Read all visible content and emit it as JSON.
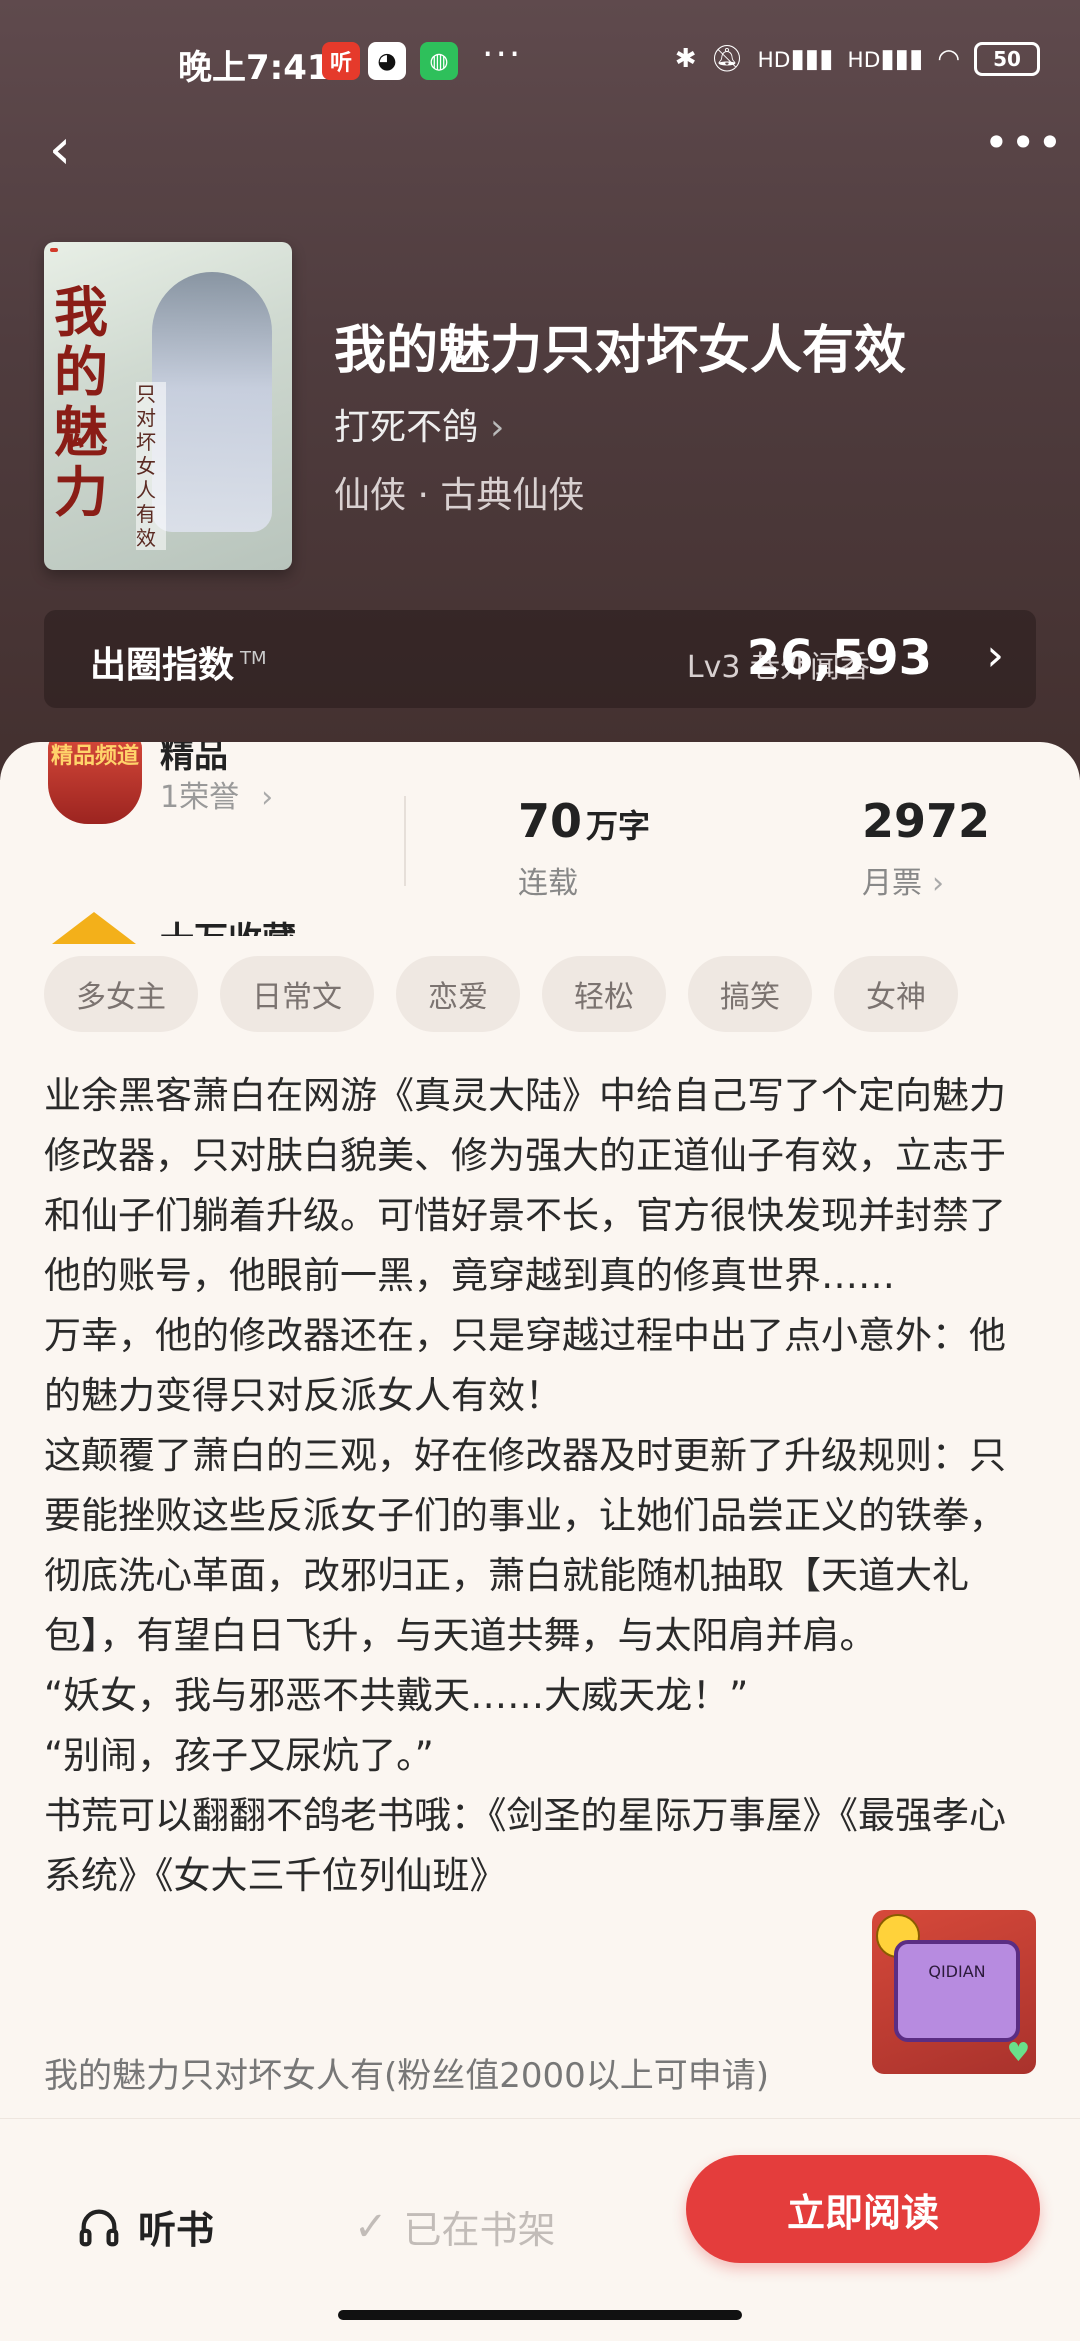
{
  "status_bar": {
    "time": "晚上7:41",
    "battery": "50",
    "signal1": "HD",
    "signal2": "HD"
  },
  "book": {
    "title": "我的魅力只对坏女人有效",
    "author": "打死不鸽",
    "genre": "仙侠 · 古典仙侠",
    "cover_title": "我的魅力",
    "cover_subtitle": "只对坏女人有效"
  },
  "index": {
    "label": "出圈指数",
    "tm": "TM",
    "level": "Lv3 巷外闻香",
    "value": "26,593"
  },
  "honor": {
    "title": "精品",
    "count": "1荣誉",
    "icon_text": "精品频道"
  },
  "stats": [
    {
      "num": "70",
      "unit": "万字",
      "label": "连载"
    },
    {
      "num": "2972",
      "unit": "",
      "label": "月票"
    }
  ],
  "collection_title": "十万收藏",
  "tags": [
    "多女主",
    "日常文",
    "恋爱",
    "轻松",
    "搞笑",
    "女神"
  ],
  "synopsis": "业余黑客萧白在网游《真灵大陆》中给自己写了个定向魅力修改器，只对肤白貌美、修为强大的正道仙子有效，立志于和仙子们躺着升级。可惜好景不长，官方很快发现并封禁了他的账号，他眼前一黑，竟穿越到真的修真世界……\n万幸，他的修改器还在，只是穿越过程中出了点小意外：他的魅力变得只对反派女人有效！\n这颠覆了萧白的三观，好在修改器及时更新了升级规则：只要能挫败这些反派女子们的事业，让她们品尝正义的铁拳，彻底洗心革面，改邪归正，萧白就能随机抽取【天道大礼包】，有望白日飞升，与天道共舞，与太阳肩并肩。\n“妖女，我与邪恶不共戴天……大威天龙！”\n“别闹，孩子又尿炕了。”\n书荒可以翻翻不鸽老书哦：《剑圣的星际万事屋》《最强孝心系统》《女大三千位列仙班》",
  "group_info": "我的魅力只对坏女人有(粉丝值2000以上可申请)",
  "widget": {
    "text": "QIDIAN"
  },
  "bottom": {
    "listen": "听书",
    "shelf": "已在书架",
    "read": "立即阅读"
  },
  "colors": {
    "accent": "#e43d3c",
    "header_bg": "#4f3c3e",
    "sheet_bg": "#fbf6f1"
  }
}
